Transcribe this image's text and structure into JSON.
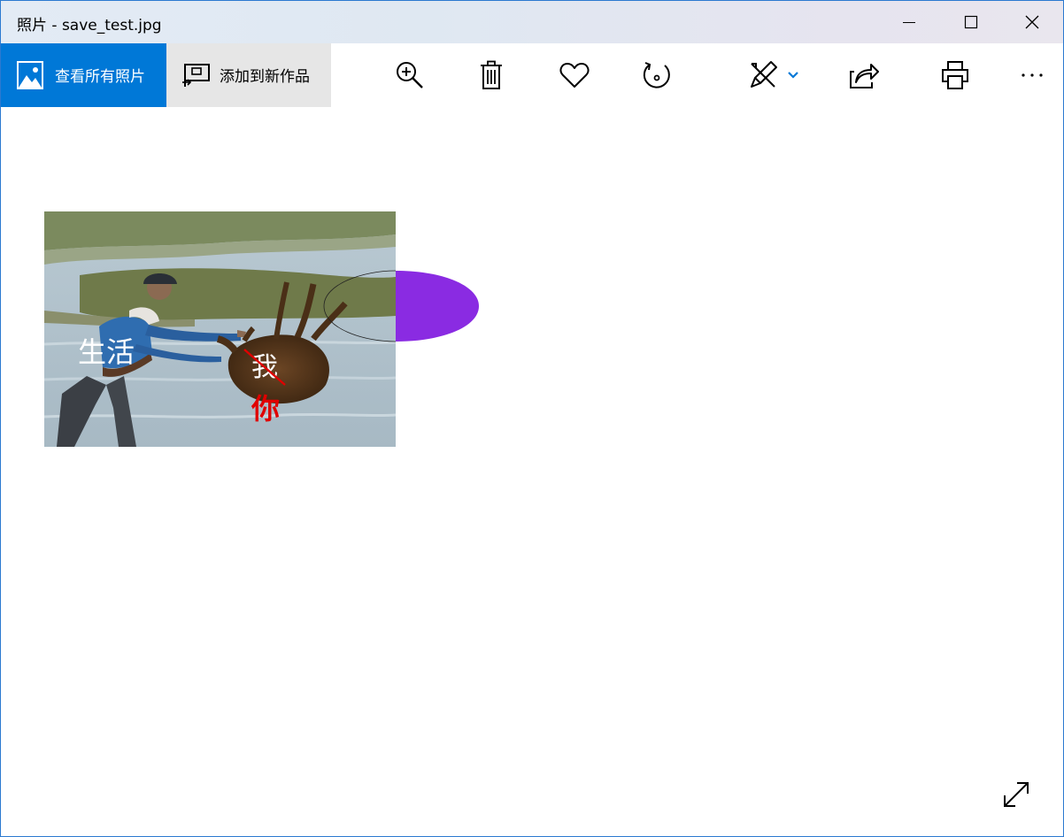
{
  "window": {
    "title": "照片 - save_test.jpg"
  },
  "toolbar": {
    "view_all_label": "查看所有照片",
    "add_to_creation_label": "添加到新作品",
    "accent_color": "#0078d7",
    "icons": [
      "zoom-in-icon",
      "delete-icon",
      "favorite-icon",
      "rotate-icon",
      "edit-draw-icon",
      "chevron-down-icon",
      "share-icon",
      "print-icon",
      "more-icon"
    ]
  },
  "photo": {
    "caption_life": "生活",
    "caption_me": "我",
    "caption_you": "你",
    "shape_fill": "#8a2be2"
  }
}
